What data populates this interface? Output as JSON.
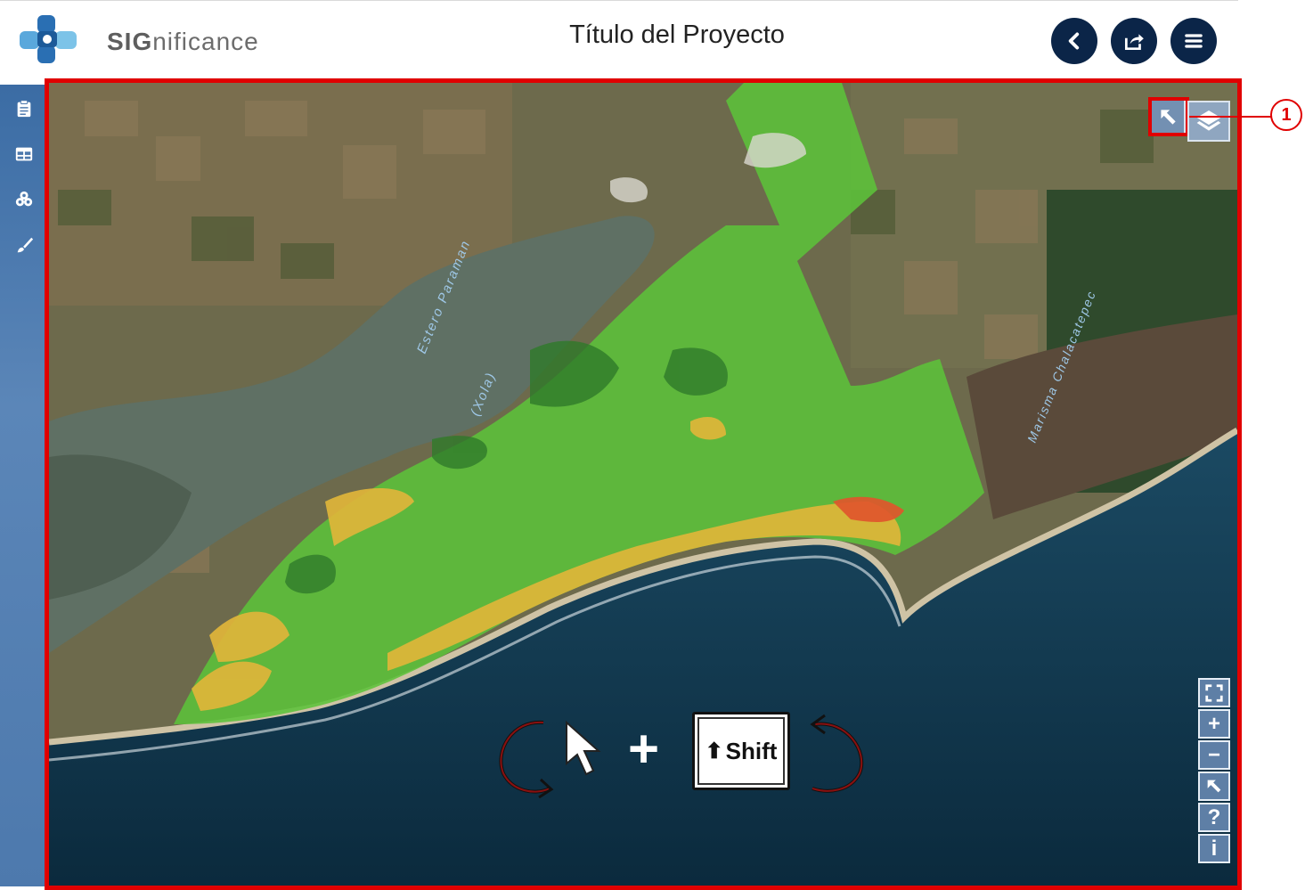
{
  "header": {
    "brand_bold": "SIG",
    "brand_rest": "nificance",
    "title": "Título del Proyecto",
    "buttons": [
      "back",
      "share",
      "menu"
    ]
  },
  "sidebar": {
    "items": [
      {
        "icon": "clipboard-icon"
      },
      {
        "icon": "table-icon"
      },
      {
        "icon": "layers-stack-icon"
      },
      {
        "icon": "paintbrush-icon"
      }
    ]
  },
  "map": {
    "labels": {
      "estero": "Estero Paraman",
      "estero_sub": "(Xola)",
      "marisma": "Marisma Chalacatepec"
    },
    "controls": [
      "fullscreen",
      "zoom-in",
      "zoom-out",
      "reset-north",
      "help",
      "info"
    ],
    "zoom_in": "+",
    "zoom_out": "−",
    "help": "?",
    "info": "i"
  },
  "hint": {
    "key_label": "Shift",
    "plus": "+"
  },
  "callout": {
    "number": "1"
  },
  "colors": {
    "highlight": "#e00000",
    "header_button": "#0b2548",
    "sidebar": "#4d79ad",
    "ocean": "#0e2f45",
    "zone_green": "#5cc23a",
    "zone_yellow": "#e0b53a",
    "zone_red": "#e0562d"
  }
}
